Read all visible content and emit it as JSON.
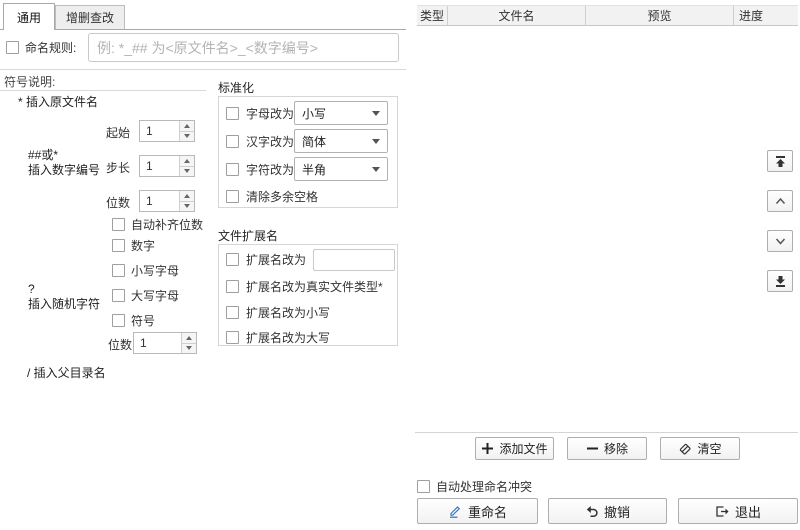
{
  "tabs": [
    {
      "label": "通用",
      "active": true
    },
    {
      "label": "增删查改",
      "active": false
    }
  ],
  "rule": {
    "checkbox_label": "命名规则:",
    "placeholder": "例: *_## 为<原文件名>_<数字编号>"
  },
  "symbols": {
    "title": "符号说明:",
    "original": "* 插入原文件名",
    "numbering": {
      "symbol_line1": "##或*",
      "symbol_line2": "插入数字编号",
      "start_label": "起始",
      "start_value": "1",
      "step_label": "步长",
      "step_value": "1",
      "digits_label": "位数",
      "digits_value": "1",
      "autopad_label": "自动补齐位数"
    },
    "random": {
      "symbol_line1": "?",
      "symbol_line2": "插入随机字符",
      "options": [
        "数字",
        "小写字母",
        "大写字母",
        "符号"
      ],
      "digits_label": "位数",
      "digits_value": "1"
    },
    "parent": "/ 插入父目录名"
  },
  "normalize": {
    "title": "标准化",
    "rows": [
      {
        "label": "字母改为",
        "value": "小写"
      },
      {
        "label": "汉字改为",
        "value": "简体"
      },
      {
        "label": "字符改为",
        "value": "半角"
      }
    ],
    "trim_label": "清除多余空格"
  },
  "extension": {
    "title": "文件扩展名",
    "change_to_label": "扩展名改为",
    "real_type_label": "扩展名改为真实文件类型*",
    "lower_label": "扩展名改为小写",
    "upper_label": "扩展名改为大写"
  },
  "table": {
    "headers": [
      "类型",
      "文件名",
      "预览",
      "进度"
    ]
  },
  "file_actions": {
    "add": "添加文件",
    "remove": "移除",
    "clear": "清空"
  },
  "conflict_label": "自动处理命名冲突",
  "main_actions": {
    "rename": "重命名",
    "undo": "撤销",
    "exit": "退出"
  },
  "icons": {
    "add": "plus",
    "remove": "minus",
    "clear": "eraser",
    "rename": "blue-pencil",
    "undo": "undo-arrow",
    "exit": "exit-door",
    "move_top": "arrow-to-top",
    "move_up": "chevron-up",
    "move_down": "chevron-down",
    "move_bottom": "arrow-to-bottom"
  },
  "colors": {
    "accent_pencil": "#3c78c0",
    "header_bg": "#f2f2f2",
    "border": "#aeaeae"
  }
}
